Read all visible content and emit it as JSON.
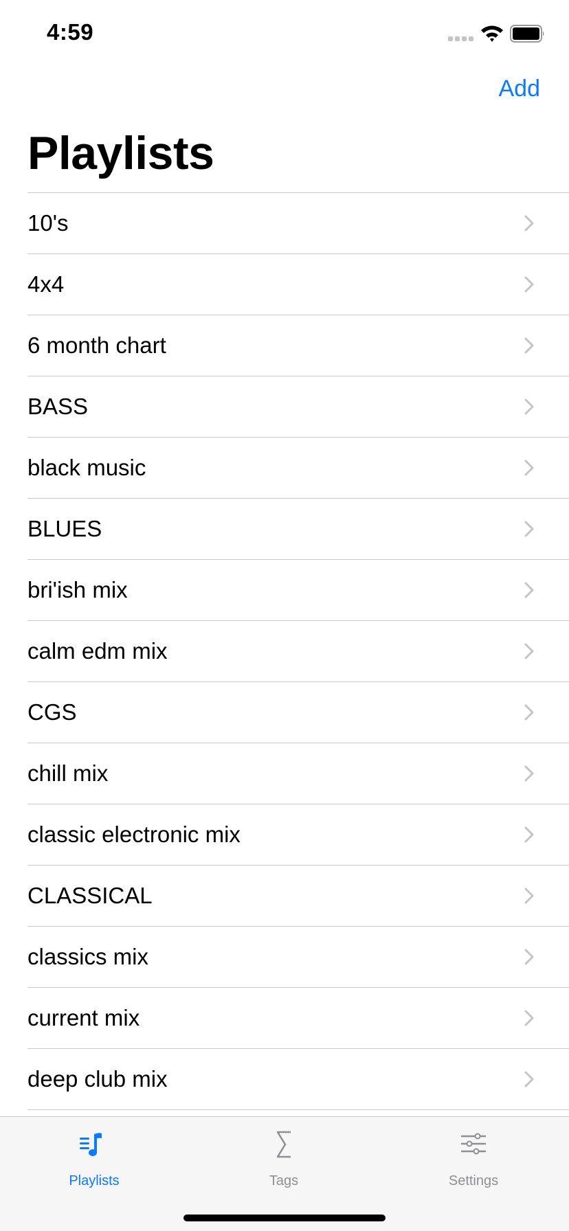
{
  "status_bar": {
    "time": "4:59",
    "icons": [
      "signal-dots-icon",
      "wifi-icon",
      "battery-icon"
    ]
  },
  "nav": {
    "add_label": "Add",
    "title": "Playlists"
  },
  "playlists": [
    {
      "label": "10's"
    },
    {
      "label": "4x4"
    },
    {
      "label": "6 month chart"
    },
    {
      "label": "BASS"
    },
    {
      "label": "black music"
    },
    {
      "label": "BLUES"
    },
    {
      "label": "bri'ish mix"
    },
    {
      "label": "calm edm mix"
    },
    {
      "label": "CGS"
    },
    {
      "label": "chill mix"
    },
    {
      "label": "classic electronic mix"
    },
    {
      "label": "CLASSICAL"
    },
    {
      "label": "classics mix"
    },
    {
      "label": "current mix"
    },
    {
      "label": "deep club mix"
    }
  ],
  "tab_bar": {
    "tabs": [
      {
        "label": "Playlists",
        "icon": "music-list-icon",
        "active": true
      },
      {
        "label": "Tags",
        "icon": "sigma-icon",
        "active": false
      },
      {
        "label": "Settings",
        "icon": "sliders-icon",
        "active": false
      }
    ]
  },
  "colors": {
    "accent": "#0a7aff",
    "inactive": "#8e8e93",
    "separator": "#c8c8cc",
    "chevron": "#c4c4c7",
    "tab_bar_bg": "#f6f6f6"
  }
}
